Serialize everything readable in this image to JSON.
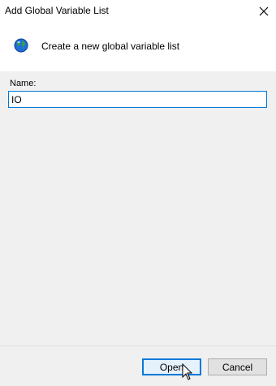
{
  "window": {
    "title": "Add Global Variable List"
  },
  "header": {
    "text": "Create a new global variable list",
    "icon": "globe-icon"
  },
  "form": {
    "name_label": "Name:",
    "name_value": "IO"
  },
  "buttons": {
    "open": "Open",
    "cancel": "Cancel"
  },
  "colors": {
    "accent": "#0078d7",
    "panel": "#f0f0f0"
  }
}
